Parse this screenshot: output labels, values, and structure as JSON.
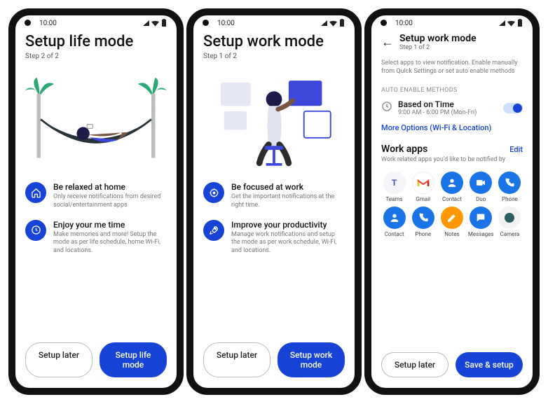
{
  "status_time": "10:00",
  "screens": [
    {
      "title": "Setup life mode",
      "step": "Step 2 of 2",
      "features": [
        {
          "icon": "home-icon",
          "title": "Be relaxed at home",
          "desc": "Only receive notifications from desired social/entertainment apps"
        },
        {
          "icon": "clock-icon",
          "title": "Enjoy your me time",
          "desc": "Make memories and more! Setup the mode as per life schedule, home Wi-Fi, and locations."
        }
      ],
      "btn_secondary": "Setup later",
      "btn_primary": "Setup life mode"
    },
    {
      "title": "Setup work mode",
      "step": "Step 1 of 2",
      "features": [
        {
          "icon": "target-icon",
          "title": "Be focused at work",
          "desc": "Get the important notifications at the right  time."
        },
        {
          "icon": "rocket-icon",
          "title": "Improve your productivity",
          "desc": "Manage work notifications and setup the mode as per work schedule, Wi-Fi, and locations."
        }
      ],
      "btn_secondary": "Setup later",
      "btn_primary": "Setup work mode"
    },
    {
      "header_title": "Setup work mode",
      "header_step": "Step 1 of 2",
      "intro": "Select apps to view notification. Enable manually from Quick Settings or set auto enable methods",
      "section_auto_enable": "AUTO ENABLE METHODS",
      "method": {
        "title": "Based on Time",
        "sub": "9:00 AM - 6:00 PM (Mon-Fri)",
        "toggle_on": true
      },
      "more_options": "More Options (Wi-Fi & Location)",
      "work_apps_title": "Work apps",
      "work_apps_edit": "Edit",
      "work_apps_sub": "Work related apps you'd like to be notified by",
      "apps": [
        {
          "name": "Teams",
          "class": "teams"
        },
        {
          "name": "Gmail",
          "class": "gmail"
        },
        {
          "name": "Contact",
          "class": "contact"
        },
        {
          "name": "Duo",
          "class": "duo"
        },
        {
          "name": "Phone",
          "class": "phone-app"
        },
        {
          "name": "Contact",
          "class": "contact2"
        },
        {
          "name": "Phone",
          "class": "phone2"
        },
        {
          "name": "Notes",
          "class": "notes"
        },
        {
          "name": "Messages",
          "class": "messages"
        },
        {
          "name": "Camera",
          "class": "camera"
        }
      ],
      "btn_secondary": "Setup later",
      "btn_primary": "Save & setup"
    }
  ],
  "colors": {
    "accent": "#1744d6",
    "blue_google": "#1b73e8",
    "orange": "#ff9800"
  }
}
